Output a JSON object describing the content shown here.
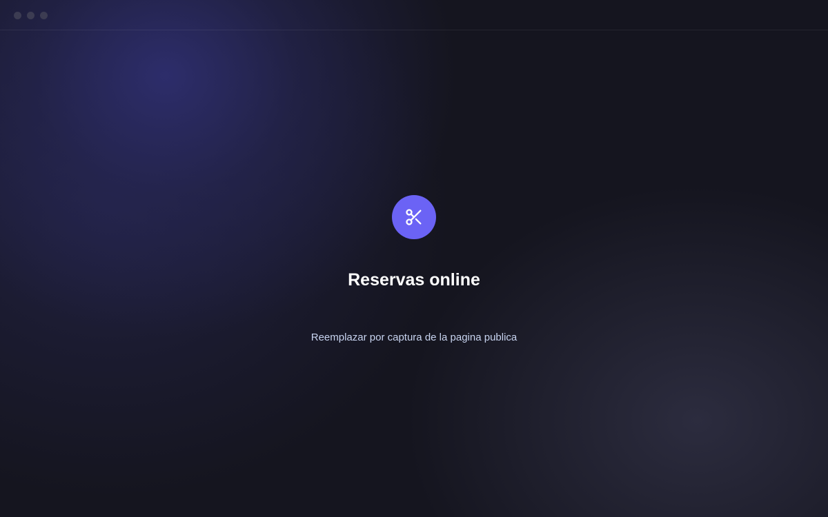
{
  "window": {
    "controls": [
      "close",
      "minimize",
      "maximize"
    ]
  },
  "main": {
    "icon": "scissors-icon",
    "title": "Reservas online",
    "subtitle": "Reemplazar por captura de la pagina publica"
  },
  "colors": {
    "accent": "#6b63f5",
    "background": "#15151f",
    "title_text": "#ffffff",
    "subtitle_text": "#c8d4f0"
  }
}
